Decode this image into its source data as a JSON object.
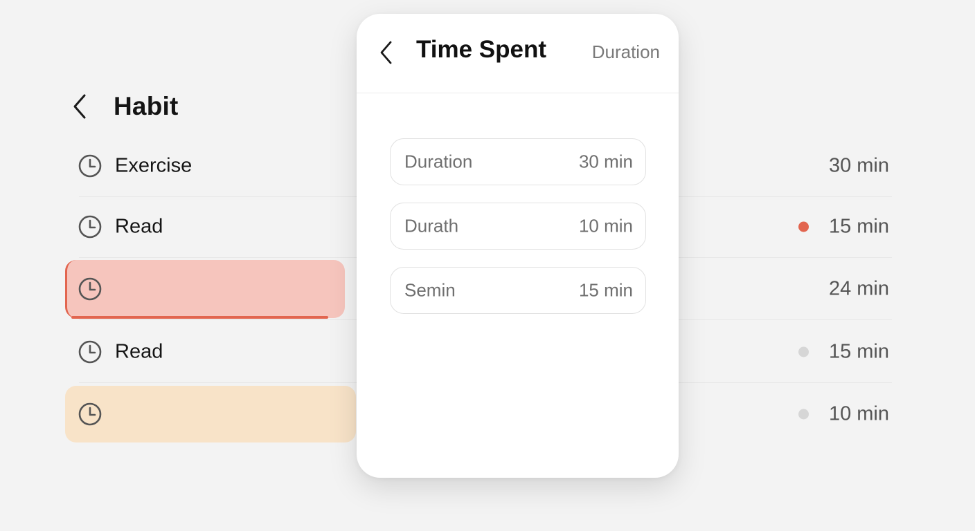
{
  "background": {
    "title": "Habit",
    "rows": [
      {
        "name": "Exercise",
        "time": "30 min",
        "dot": "none"
      },
      {
        "name": "Read",
        "time": "15 min",
        "dot": "red"
      },
      {
        "name": "",
        "time": "24 min",
        "dot": "none"
      },
      {
        "name": "Read",
        "time": "15 min",
        "dot": "gray"
      },
      {
        "name": "",
        "time": "10 min",
        "dot": "gray"
      }
    ]
  },
  "card": {
    "title": "Time Spent",
    "action": "Duration",
    "fields": [
      {
        "label": "Duration",
        "value": "30 min"
      },
      {
        "label": "Durath",
        "value": "10 min"
      },
      {
        "label": "Semin",
        "value": "15 min"
      }
    ]
  },
  "colors": {
    "accent_red": "#e2654f",
    "dot_gray": "#d6d6d6",
    "highlight_red": "#f6c5bd",
    "highlight_orange": "#f8e3c8"
  },
  "icons": {
    "back": "chevron-left-icon",
    "clock": "clock-icon"
  }
}
